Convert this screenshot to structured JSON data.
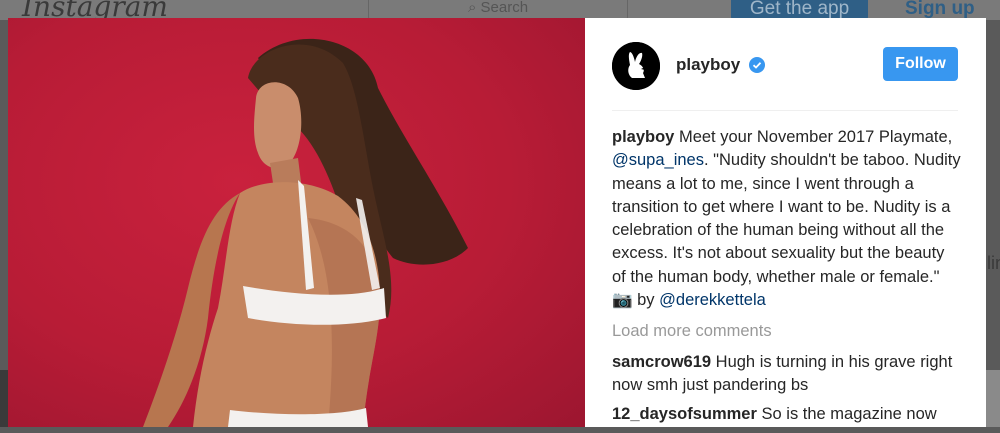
{
  "background_page": {
    "logo": "Instagram",
    "search_placeholder": "Search",
    "get_app_label": "Get the app",
    "sign_up_label": "Sign up",
    "side_text": "lin"
  },
  "post": {
    "username": "playboy",
    "verified": true,
    "follow_label": "Follow",
    "caption": {
      "username": "playboy",
      "part1": " Meet your November 2017 Playmate, ",
      "mention": "@supa_ines",
      "part2": ". \"Nudity shouldn't be taboo. Nudity means a lot to me, since I went through a transition to get where I want to be. Nudity is a celebration of the human being without all the excess. It's not about sexuality but the beauty of the human body, whether male or female.\" ",
      "camera_glyph": "📷",
      "part3": " by ",
      "credit": "@derekkettela"
    },
    "load_more_label": "Load more comments",
    "comments": [
      {
        "username": "samcrow619",
        "text": " Hugh is turning in his grave right now smh just pandering bs"
      },
      {
        "username": "12_daysofsummer",
        "text": " So is the magazine now"
      }
    ]
  },
  "colors": {
    "follow_button": "#3897f0",
    "photo_background": "#b81c36",
    "mention": "#003569"
  }
}
